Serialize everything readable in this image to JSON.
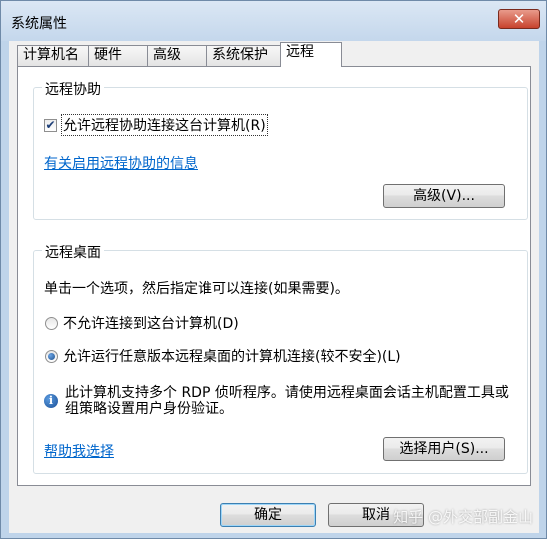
{
  "window": {
    "title": "系统属性",
    "close_glyph": "✕"
  },
  "tabs": [
    {
      "label": "计算机名"
    },
    {
      "label": "硬件"
    },
    {
      "label": "高级"
    },
    {
      "label": "系统保护"
    },
    {
      "label": "远程"
    }
  ],
  "active_tab": "远程",
  "remote_assistance": {
    "legend": "远程协助",
    "allow_checked": true,
    "allow_label": "允许远程协助连接这台计算机(R)",
    "info_link": "有关启用远程协助的信息",
    "advanced_button": "高级(V)..."
  },
  "remote_desktop": {
    "legend": "远程桌面",
    "instruction": "单击一个选项，然后指定谁可以连接(如果需要)。",
    "options": [
      {
        "label": "不允许连接到这台计算机(D)",
        "checked": false
      },
      {
        "label": "允许运行任意版本远程桌面的计算机连接(较不安全)(L)",
        "checked": true
      }
    ],
    "info_text": "此计算机支持多个 RDP 侦听程序。请使用远程桌面会话主机配置工具或组策略设置用户身份验证。",
    "help_link": "帮助我选择",
    "select_users_button": "选择用户(S)..."
  },
  "footer": {
    "ok_button": "确定",
    "cancel_button": "取消"
  },
  "watermark": "知乎 @外交部副金山",
  "colors": {
    "link": "#0066cc",
    "close_button": "#c7432d",
    "title_bar": "#c4d7ec"
  }
}
